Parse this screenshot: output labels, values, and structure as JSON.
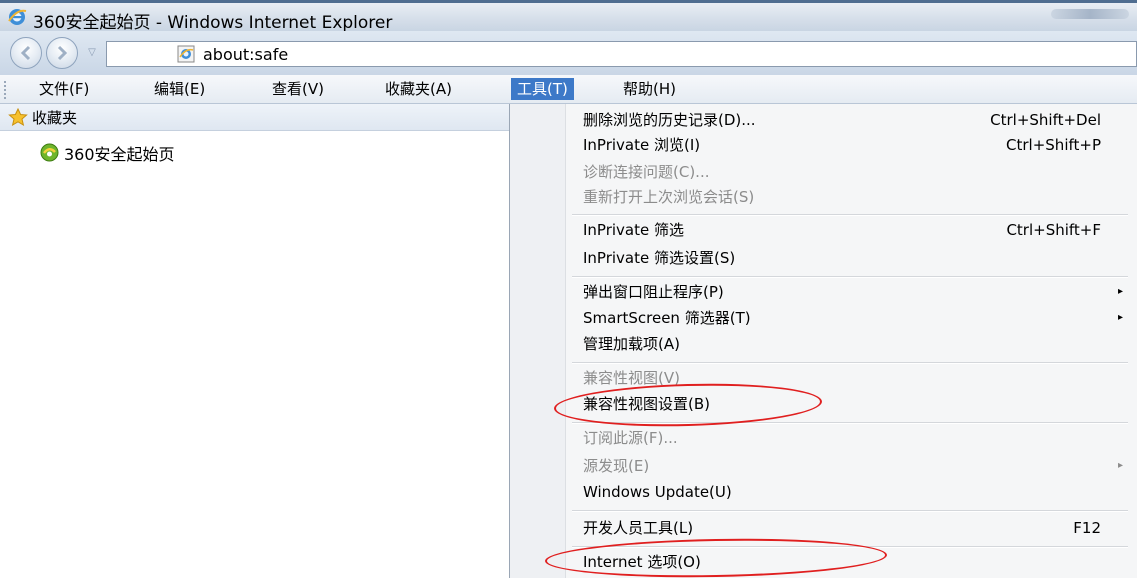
{
  "window": {
    "title": "360安全起始页 - Windows Internet Explorer"
  },
  "address_bar": {
    "url": "about:safe"
  },
  "menubar": {
    "items": [
      {
        "label": "文件(F)"
      },
      {
        "label": "编辑(E)"
      },
      {
        "label": "查看(V)"
      },
      {
        "label": "收藏夹(A)"
      },
      {
        "label": "工具(T)",
        "active": true
      },
      {
        "label": "帮助(H)"
      }
    ]
  },
  "favorites": {
    "header": "收藏夹",
    "items": [
      {
        "label": "360安全起始页"
      }
    ]
  },
  "tools_menu": {
    "items": [
      {
        "label": "删除浏览的历史记录(D)...",
        "shortcut": "Ctrl+Shift+Del"
      },
      {
        "label": "InPrivate 浏览(I)",
        "shortcut": "Ctrl+Shift+P"
      },
      {
        "label": "诊断连接问题(C)...",
        "disabled": true
      },
      {
        "label": "重新打开上次浏览会话(S)",
        "disabled": true
      },
      {
        "label": "InPrivate 筛选",
        "shortcut": "Ctrl+Shift+F"
      },
      {
        "label": "InPrivate 筛选设置(S)"
      },
      {
        "label": "弹出窗口阻止程序(P)",
        "submenu": true
      },
      {
        "label": "SmartScreen 筛选器(T)",
        "submenu": true
      },
      {
        "label": "管理加载项(A)"
      },
      {
        "label": "兼容性视图(V)",
        "disabled": true
      },
      {
        "label": "兼容性视图设置(B)",
        "highlighted": true
      },
      {
        "label": "订阅此源(F)...",
        "disabled": true
      },
      {
        "label": "源发现(E)",
        "disabled": true,
        "submenu": true
      },
      {
        "label": "Windows Update(U)"
      },
      {
        "label": "开发人员工具(L)",
        "shortcut": "F12"
      },
      {
        "label": "Internet 选项(O)",
        "highlighted": true
      }
    ],
    "submenu_arrow": "▸"
  },
  "colors": {
    "menu_active": "#3d79c8",
    "annotation": "#e01f1f"
  }
}
